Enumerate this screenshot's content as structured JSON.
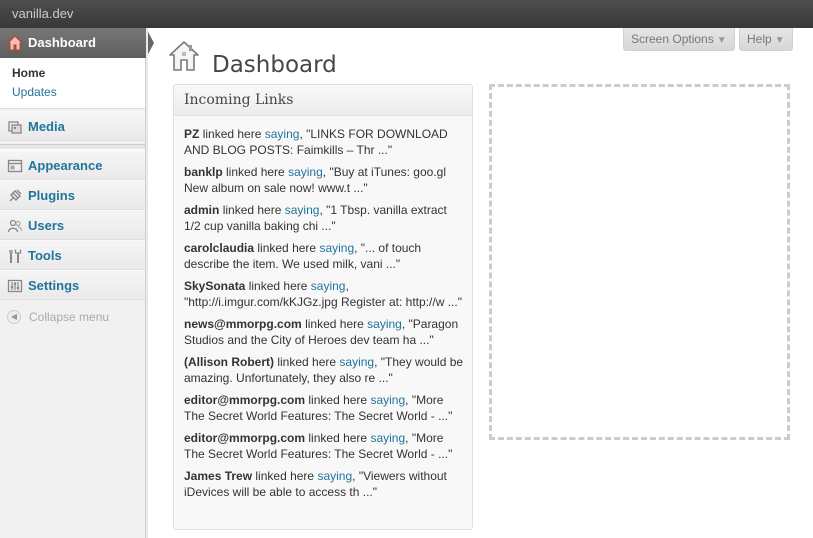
{
  "admin_bar": {
    "site_name": "vanilla.dev"
  },
  "sidebar": {
    "current": {
      "label": "Dashboard",
      "icon": "home-icon"
    },
    "submenu": [
      {
        "label": "Home",
        "current": true
      },
      {
        "label": "Updates",
        "current": false
      }
    ],
    "items": [
      {
        "label": "Media",
        "icon": "media-icon"
      },
      {
        "label": "Appearance",
        "icon": "appearance-icon"
      },
      {
        "label": "Plugins",
        "icon": "plugins-icon"
      },
      {
        "label": "Users",
        "icon": "users-icon"
      },
      {
        "label": "Tools",
        "icon": "tools-icon"
      },
      {
        "label": "Settings",
        "icon": "settings-icon"
      }
    ],
    "collapse_label": "Collapse menu"
  },
  "header": {
    "title": "Dashboard",
    "screen_options_label": "Screen Options",
    "help_label": "Help"
  },
  "widget": {
    "title": "Incoming Links",
    "linked_text": "linked here",
    "saying_text": "saying",
    "links": [
      {
        "author": "PZ",
        "excerpt": "\"LINKS FOR DOWNLOAD AND BLOG POSTS: Faimkills – Thr ...\""
      },
      {
        "author": "banklp",
        "excerpt": "\"Buy at iTunes: goo.gl New album on sale now! www.t ...\""
      },
      {
        "author": "admin",
        "excerpt": "\"1 Tbsp. vanilla extract 1/2 cup vanilla baking chi ...\""
      },
      {
        "author": "carolclaudia",
        "excerpt": "\"... of touch describe the item. We used milk, vani ...\""
      },
      {
        "author": "SkySonata",
        "excerpt": "\"http://i.imgur.com/kKJGz.jpg Register at: http://w ...\""
      },
      {
        "author": "news@mmorpg.com",
        "excerpt": "\"Paragon Studios and the City of Heroes dev team ha ...\""
      },
      {
        "author": "(Allison Robert)",
        "excerpt": "\"They would be amazing. Unfortunately, they also re ...\""
      },
      {
        "author": "editor@mmorpg.com",
        "excerpt": "\"More The Secret World Features: The Secret World - ...\""
      },
      {
        "author": "editor@mmorpg.com",
        "excerpt": "\"More The Secret World Features: The Secret World - ...\""
      },
      {
        "author": "James Trew",
        "excerpt": "\"Viewers without iDevices will be able to access th ...\""
      }
    ]
  },
  "colors": {
    "link": "#21759b",
    "admin_bar": "#464646",
    "menu_current": "#6d6d6d"
  }
}
